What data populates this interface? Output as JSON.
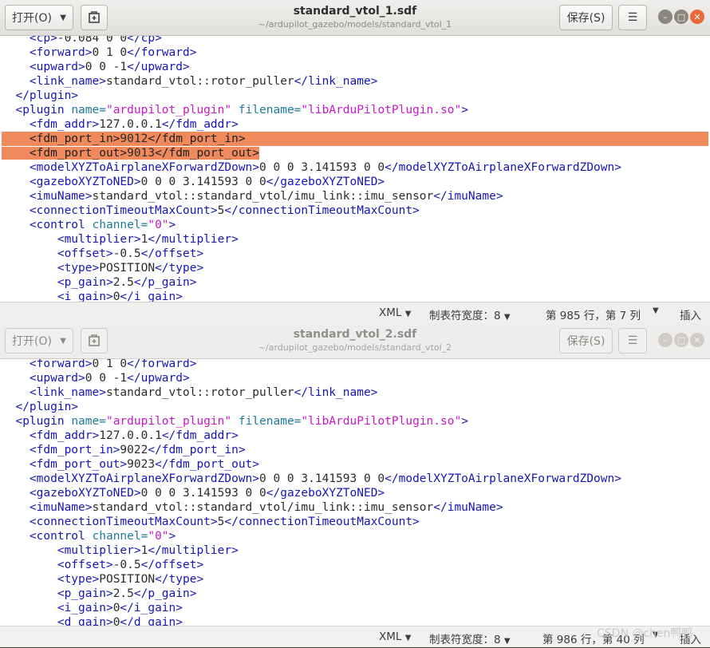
{
  "windows": [
    {
      "open_label": "打开(O)",
      "title": "standard_vtol_1.sdf",
      "path": "~/ardupilot_gazebo/models/standard_vtol_1",
      "save_label": "保存(S)",
      "lines": [
        [
          [
            "    ",
            "p"
          ],
          [
            "<cp>",
            "tag"
          ],
          [
            "-0.084 0 0",
            "p"
          ],
          [
            "</cp>",
            "tag"
          ]
        ],
        [
          [
            "    ",
            "p"
          ],
          [
            "<forward>",
            "tag"
          ],
          [
            "0 1 0",
            "p"
          ],
          [
            "</forward>",
            "tag"
          ]
        ],
        [
          [
            "    ",
            "p"
          ],
          [
            "<upward>",
            "tag"
          ],
          [
            "0 0 -1",
            "p"
          ],
          [
            "</upward>",
            "tag"
          ]
        ],
        [
          [
            "    ",
            "p"
          ],
          [
            "<link_name>",
            "tag"
          ],
          [
            "standard_vtol::rotor_puller",
            "p"
          ],
          [
            "</link_name>",
            "tag"
          ]
        ],
        [
          [
            "  ",
            "p"
          ],
          [
            "</plugin>",
            "tag"
          ]
        ],
        [
          [
            "  ",
            "p"
          ],
          [
            "<plugin ",
            "tag"
          ],
          [
            "name=",
            "attr"
          ],
          [
            "\"ardupilot_plugin\"",
            "val"
          ],
          [
            " ",
            "p"
          ],
          [
            "filename=",
            "attr"
          ],
          [
            "\"libArduPilotPlugin.so\"",
            "val"
          ],
          [
            ">",
            "tag"
          ]
        ],
        [
          [
            "    ",
            "p"
          ],
          [
            "<fdm_addr>",
            "tag"
          ],
          [
            "127.0.0.1",
            "p"
          ],
          [
            "</fdm_addr>",
            "tag"
          ]
        ],
        [
          [
            "    ",
            "p"
          ],
          [
            "<fdm_port_in>",
            "tag"
          ],
          [
            "9012",
            "p"
          ],
          [
            "</fdm_port_in>",
            "tag"
          ]
        ],
        [
          [
            "    ",
            "p"
          ],
          [
            "<fdm_port_out>",
            "tag"
          ],
          [
            "9013",
            "p"
          ],
          [
            "</fdm_port_out>",
            "tag"
          ]
        ],
        [
          [
            "    ",
            "p"
          ],
          [
            "<modelXYZToAirplaneXForwardZDown>",
            "tag"
          ],
          [
            "0 0 0 3.141593 0 0",
            "p"
          ],
          [
            "</modelXYZToAirplaneXForwardZDown>",
            "tag"
          ]
        ],
        [
          [
            "    ",
            "p"
          ],
          [
            "<gazeboXYZToNED>",
            "tag"
          ],
          [
            "0 0 0 3.141593 0 0",
            "p"
          ],
          [
            "</gazeboXYZToNED>",
            "tag"
          ]
        ],
        [
          [
            "    ",
            "p"
          ],
          [
            "<imuName>",
            "tag"
          ],
          [
            "standard_vtol::standard_vtol/imu_link::imu_sensor",
            "p"
          ],
          [
            "</imuName>",
            "tag"
          ]
        ],
        [
          [
            "    ",
            "p"
          ],
          [
            "<connectionTimeoutMaxCount>",
            "tag"
          ],
          [
            "5",
            "p"
          ],
          [
            "</connectionTimeoutMaxCount>",
            "tag"
          ]
        ],
        [
          [
            "    ",
            "p"
          ],
          [
            "<control ",
            "tag"
          ],
          [
            "channel=",
            "attr"
          ],
          [
            "\"0\"",
            "val"
          ],
          [
            ">",
            "tag"
          ]
        ],
        [
          [
            "        ",
            "p"
          ],
          [
            "<multiplier>",
            "tag"
          ],
          [
            "1",
            "p"
          ],
          [
            "</multiplier>",
            "tag"
          ]
        ],
        [
          [
            "        ",
            "p"
          ],
          [
            "<offset>",
            "tag"
          ],
          [
            "-0.5",
            "p"
          ],
          [
            "</offset>",
            "tag"
          ]
        ],
        [
          [
            "        ",
            "p"
          ],
          [
            "<type>",
            "tag"
          ],
          [
            "POSITION",
            "p"
          ],
          [
            "</type>",
            "tag"
          ]
        ],
        [
          [
            "        ",
            "p"
          ],
          [
            "<p_gain>",
            "tag"
          ],
          [
            "2.5",
            "p"
          ],
          [
            "</p_gain>",
            "tag"
          ]
        ],
        [
          [
            "        ",
            "p"
          ],
          [
            "<i_gain>",
            "tag"
          ],
          [
            "0",
            "p"
          ],
          [
            "</i_gain>",
            "tag"
          ]
        ]
      ],
      "highlight_full": [
        7
      ],
      "highlight_part": [
        8
      ],
      "status": {
        "language": "XML",
        "tab_width": "制表符宽度：8",
        "position": "第 985 行，第 7 列",
        "insert_mode": "插入"
      }
    },
    {
      "open_label": "打开(O)",
      "title": "standard_vtol_2.sdf",
      "path": "~/ardupilot_gazebo/models/standard_vtol_2",
      "save_label": "保存(S)",
      "lines": [
        [
          [
            "    ",
            "p"
          ],
          [
            "<forward>",
            "tag"
          ],
          [
            "0 1 0",
            "p"
          ],
          [
            "</forward>",
            "tag"
          ]
        ],
        [
          [
            "    ",
            "p"
          ],
          [
            "<upward>",
            "tag"
          ],
          [
            "0 0 -1",
            "p"
          ],
          [
            "</upward>",
            "tag"
          ]
        ],
        [
          [
            "    ",
            "p"
          ],
          [
            "<link_name>",
            "tag"
          ],
          [
            "standard_vtol::rotor_puller",
            "p"
          ],
          [
            "</link_name>",
            "tag"
          ]
        ],
        [
          [
            "  ",
            "p"
          ],
          [
            "</plugin>",
            "tag"
          ]
        ],
        [
          [
            "  ",
            "p"
          ],
          [
            "<plugin ",
            "tag"
          ],
          [
            "name=",
            "attr"
          ],
          [
            "\"ardupilot_plugin\"",
            "val"
          ],
          [
            " ",
            "p"
          ],
          [
            "filename=",
            "attr"
          ],
          [
            "\"libArduPilotPlugin.so\"",
            "val"
          ],
          [
            ">",
            "tag"
          ]
        ],
        [
          [
            "    ",
            "p"
          ],
          [
            "<fdm_addr>",
            "tag"
          ],
          [
            "127.0.0.1",
            "p"
          ],
          [
            "</fdm_addr>",
            "tag"
          ]
        ],
        [
          [
            "    ",
            "p"
          ],
          [
            "<fdm_port_in>",
            "tag"
          ],
          [
            "9022",
            "p"
          ],
          [
            "</fdm_port_in>",
            "tag"
          ]
        ],
        [
          [
            "    ",
            "p"
          ],
          [
            "<fdm_port_out>",
            "tag"
          ],
          [
            "9023",
            "p"
          ],
          [
            "</fdm_port_out>",
            "tag"
          ]
        ],
        [
          [
            "    ",
            "p"
          ],
          [
            "<modelXYZToAirplaneXForwardZDown>",
            "tag"
          ],
          [
            "0 0 0 3.141593 0 0",
            "p"
          ],
          [
            "</modelXYZToAirplaneXForwardZDown>",
            "tag"
          ]
        ],
        [
          [
            "    ",
            "p"
          ],
          [
            "<gazeboXYZToNED>",
            "tag"
          ],
          [
            "0 0 0 3.141593 0 0",
            "p"
          ],
          [
            "</gazeboXYZToNED>",
            "tag"
          ]
        ],
        [
          [
            "    ",
            "p"
          ],
          [
            "<imuName>",
            "tag"
          ],
          [
            "standard_vtol::standard_vtol/imu_link::imu_sensor",
            "p"
          ],
          [
            "</imuName>",
            "tag"
          ]
        ],
        [
          [
            "    ",
            "p"
          ],
          [
            "<connectionTimeoutMaxCount>",
            "tag"
          ],
          [
            "5",
            "p"
          ],
          [
            "</connectionTimeoutMaxCount>",
            "tag"
          ]
        ],
        [
          [
            "    ",
            "p"
          ],
          [
            "<control ",
            "tag"
          ],
          [
            "channel=",
            "attr"
          ],
          [
            "\"0\"",
            "val"
          ],
          [
            ">",
            "tag"
          ]
        ],
        [
          [
            "        ",
            "p"
          ],
          [
            "<multiplier>",
            "tag"
          ],
          [
            "1",
            "p"
          ],
          [
            "</multiplier>",
            "tag"
          ]
        ],
        [
          [
            "        ",
            "p"
          ],
          [
            "<offset>",
            "tag"
          ],
          [
            "-0.5",
            "p"
          ],
          [
            "</offset>",
            "tag"
          ]
        ],
        [
          [
            "        ",
            "p"
          ],
          [
            "<type>",
            "tag"
          ],
          [
            "POSITION",
            "p"
          ],
          [
            "</type>",
            "tag"
          ]
        ],
        [
          [
            "        ",
            "p"
          ],
          [
            "<p_gain>",
            "tag"
          ],
          [
            "2.5",
            "p"
          ],
          [
            "</p_gain>",
            "tag"
          ]
        ],
        [
          [
            "        ",
            "p"
          ],
          [
            "<i_gain>",
            "tag"
          ],
          [
            "0",
            "p"
          ],
          [
            "</i_gain>",
            "tag"
          ]
        ],
        [
          [
            "        ",
            "p"
          ],
          [
            "<d_gain>",
            "tag"
          ],
          [
            "0",
            "p"
          ],
          [
            "</d_gain>",
            "tag"
          ]
        ]
      ],
      "highlight_full": [],
      "highlight_part": [],
      "status": {
        "language": "XML",
        "tab_width": "制表符宽度：8",
        "position": "第 986 行，第 40 列",
        "insert_mode": "插入"
      }
    }
  ],
  "watermark": "CSDN @chen鸭鸭",
  "colors": {
    "highlight": "#f08a5d",
    "tag": "#1616b8",
    "attribute": "#1f7a9a",
    "string": "#c818c8",
    "close_button": "#ec6739"
  },
  "icons": {
    "dropdown": "chevron-down-icon",
    "pin": "new-document-icon",
    "menu": "hamburger-menu-icon",
    "minimize": "minimize-icon",
    "maximize": "maximize-icon",
    "close": "close-icon"
  }
}
